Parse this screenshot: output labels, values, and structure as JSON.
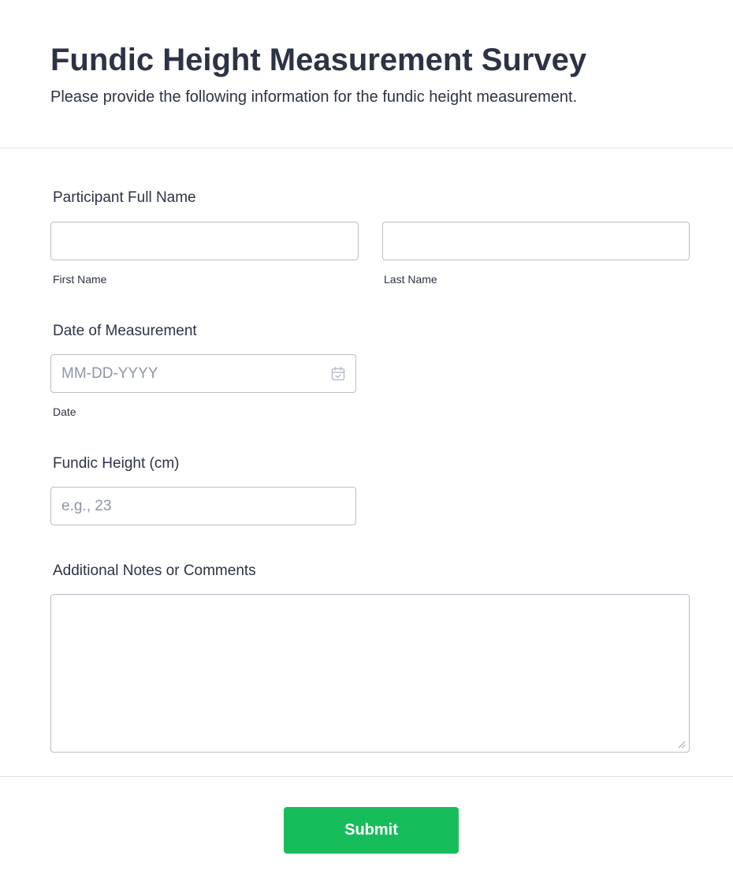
{
  "form": {
    "title": "Fundic Height Measurement Survey",
    "subtitle": "Please provide the following information for the fundic height measurement."
  },
  "participant_name": {
    "label": "Participant Full Name",
    "first_name": {
      "sublabel": "First Name",
      "value": "",
      "placeholder": ""
    },
    "last_name": {
      "sublabel": "Last Name",
      "value": "",
      "placeholder": ""
    }
  },
  "date_of_measurement": {
    "label": "Date of Measurement",
    "placeholder": "MM-DD-YYYY",
    "value": "",
    "sublabel": "Date",
    "icon": "calendar-icon"
  },
  "fundic_height": {
    "label": "Fundic Height (cm)",
    "placeholder": "e.g., 23",
    "value": ""
  },
  "notes": {
    "label": "Additional Notes or Comments",
    "value": ""
  },
  "submit": {
    "label": "Submit"
  },
  "colors": {
    "text": "#2c3345",
    "border": "#b8bdc9",
    "placeholder": "#8f96a8",
    "divider": "#e2e4ea",
    "submit_bg": "#18bd5b",
    "submit_text": "#ffffff"
  }
}
